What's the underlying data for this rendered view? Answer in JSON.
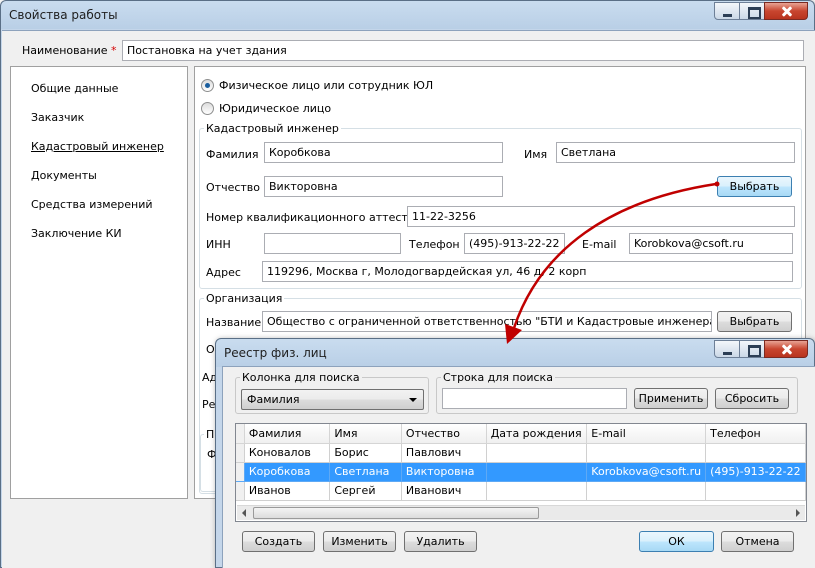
{
  "main": {
    "title": "Свойства работы",
    "name_label": "Наименование",
    "name_required": "*",
    "name_value": "Постановка на учет здания",
    "nav": [
      "Общие данные",
      "Заказчик",
      "Кадастровый инженер",
      "Документы",
      "Средства измерений",
      "Заключение КИ"
    ],
    "active_nav": "Кадастровый инженер",
    "radio_person": "Физическое лицо или сотрудник ЮЛ",
    "radio_legal": "Юридическое лицо",
    "engineer": {
      "group_label": "Кадастровый инженер",
      "surname_label": "Фамилия",
      "surname_value": "Коробкова",
      "name_label": "Имя",
      "name_value": "Светлана",
      "patronymic_label": "Отчество",
      "patronymic_value": "Викторовна",
      "select_label": "Выбрать",
      "cert_label": "Номер квалификационного аттестата",
      "cert_value": "11-22-3256",
      "inn_label": "ИНН",
      "inn_value": "",
      "phone_label": "Телефон",
      "phone_value": "(495)-913-22-22",
      "email_label": "E-mail",
      "email_value": "Korobkova@csoft.ru",
      "address_label": "Адрес",
      "address_value": "119296, Москва г, Молодогвардейская ул, 46 д, 2 корп"
    },
    "org": {
      "group_label": "Организация",
      "name_label": "Название",
      "name_value": "Общество с ограниченной ответственностью \"БТИ и Кадастровые инженера\"",
      "select_label": "Выбрать",
      "hidden_labels": [
        "О",
        "Ад",
        "Ре"
      ],
      "hidden_group_label": "П",
      "hidden_row_label": "Ф"
    }
  },
  "dialog": {
    "title": "Реестр физ. лиц",
    "search_column_label": "Колонка для поиска",
    "search_column_value": "Фамилия",
    "search_string_label": "Строка для поиска",
    "search_string_value": "",
    "apply_label": "Применить",
    "reset_label": "Сбросить",
    "columns": [
      "Фамилия",
      "Имя",
      "Отчество",
      "Дата рождения",
      "E-mail",
      "Телефон"
    ],
    "rows": [
      [
        "Коновалов",
        "Борис",
        "Павлович",
        "",
        "",
        ""
      ],
      [
        "Коробкова",
        "Светлана",
        "Викторовна",
        "",
        "Korobkova@csoft.ru",
        "(495)-913-22-22"
      ],
      [
        "Иванов",
        "Сергей",
        "Иванович",
        "",
        "",
        ""
      ]
    ],
    "selected_row": 1,
    "create_label": "Создать",
    "edit_label": "Изменить",
    "delete_label": "Удалить",
    "ok_label": "ОК",
    "cancel_label": "Отмена"
  },
  "colors": {
    "selection": "#3399ff",
    "arrow": "#c00000",
    "required": "#d40000"
  }
}
